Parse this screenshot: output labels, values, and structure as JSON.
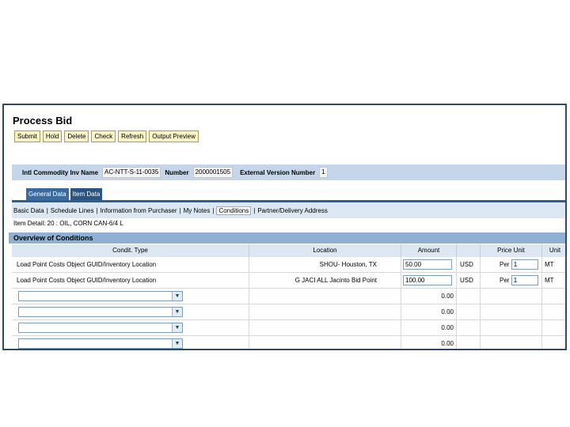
{
  "page": {
    "title": "Process Bid"
  },
  "toolbar": {
    "buttons": [
      "Submit",
      "Hold",
      "Delete",
      "Check",
      "Refresh",
      "Output Preview"
    ]
  },
  "header": {
    "label1": "Intl Commodity Inv Name",
    "value1": "AC-NTT-S-11-0035",
    "label2": "Number",
    "value2": "2000001505",
    "label3": "External Version Number",
    "value3": "1"
  },
  "tabs": [
    "General Data",
    "Item Data"
  ],
  "subtabs": [
    "Basic Data",
    "Schedule Lines",
    "Information from Purchaser",
    "My Notes",
    "Conditions",
    "Partner/Delivery Address"
  ],
  "item_detail": "Item Detail: 20 : OIL, CORN CAN-6/4 L",
  "section_title": "Overview of Conditions",
  "columns": [
    "Condit. Type",
    "Location",
    "Amount",
    "",
    "Price Unit",
    "Unit"
  ],
  "rows": [
    {
      "type": "Load Point Costs Object GUID/Inventory Location",
      "location": "SHOU- Houston, TX",
      "amount": "50.00",
      "currency": "USD",
      "per": "Per",
      "price_unit": "1",
      "unit": "MT"
    },
    {
      "type": "Load Point Costs Object GUID/Inventory Location",
      "location": "G JACI ALL Jacinto Bid Point",
      "amount": "100.00",
      "currency": "USD",
      "per": "Per",
      "price_unit": "1",
      "unit": "MT"
    }
  ],
  "empty_rows": [
    "0.00",
    "0.00",
    "0.00",
    "0.00"
  ],
  "icons": {
    "dropdown": "chevron-down-icon"
  }
}
